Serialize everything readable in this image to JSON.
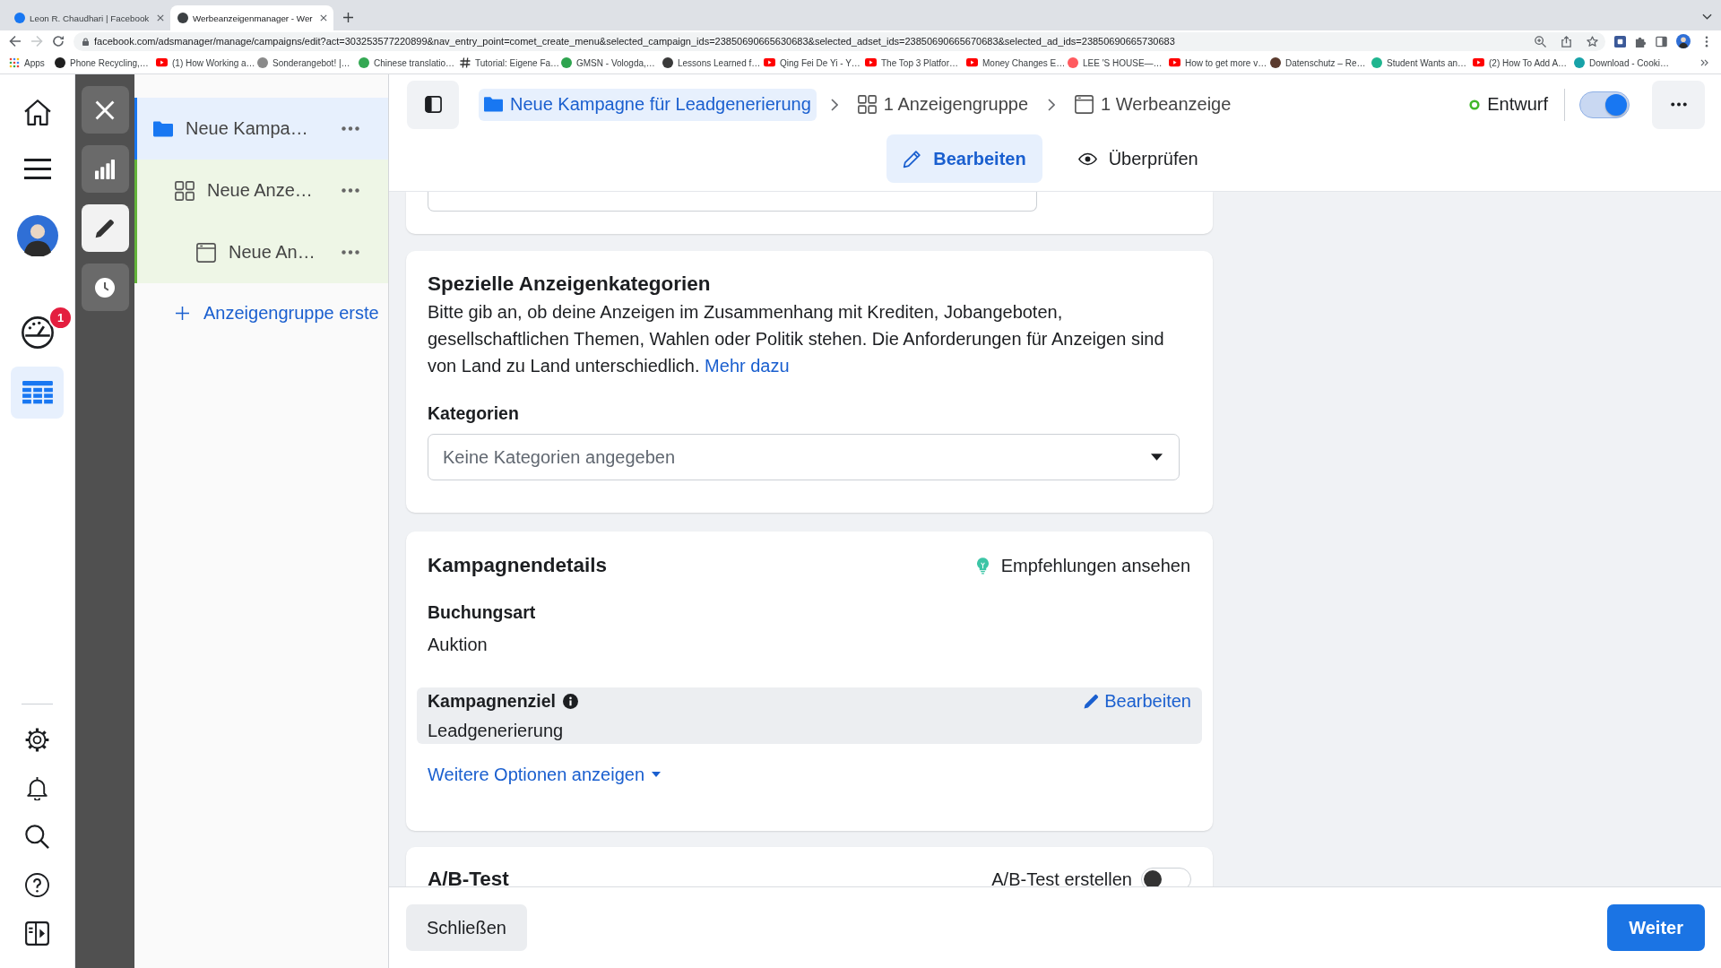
{
  "browser": {
    "tabs": [
      {
        "title": "Leon R. Chaudhari | Facebook",
        "selected": false,
        "color": "#1877f2"
      },
      {
        "title": "Werbeanzeigenmanager - Wer",
        "selected": true,
        "color": "#3c4043"
      }
    ],
    "forward_disabled": true,
    "url": "facebook.com/adsmanager/manage/campaigns/edit?act=303253577220899&nav_entry_point=comet_create_menu&selected_campaign_ids=23850690665630683&selected_adset_ids=23850690665670683&selected_ad_ids=23850690665730683",
    "bookmarks": [
      {
        "label": "Apps",
        "kind": "apps"
      },
      {
        "label": "Phone Recycling,…",
        "kind": "site",
        "color": "#1f1f1f"
      },
      {
        "label": "(1) How Working a…",
        "kind": "video"
      },
      {
        "label": "Sonderangebot! |…",
        "kind": "site",
        "color": "#8a8a8a"
      },
      {
        "label": "Chinese translatio…",
        "kind": "site",
        "color": "#34a853"
      },
      {
        "label": "Tutorial: Eigene Fa…",
        "kind": "hash"
      },
      {
        "label": "GMSN - Vologda,…",
        "kind": "site",
        "color": "#2ea44f"
      },
      {
        "label": "Lessons Learned f…",
        "kind": "site",
        "color": "#3a3a3a"
      },
      {
        "label": "Qing Fei De Yi - Y…",
        "kind": "video"
      },
      {
        "label": "The Top 3 Platfor…",
        "kind": "video"
      },
      {
        "label": "Money Changes E…",
        "kind": "video"
      },
      {
        "label": "LEE 'S HOUSE—…",
        "kind": "site",
        "color": "#ff5a5f"
      },
      {
        "label": "How to get more v…",
        "kind": "video"
      },
      {
        "label": "Datenschutz – Re…",
        "kind": "site",
        "color": "#5b3b2e"
      },
      {
        "label": "Student Wants an…",
        "kind": "site",
        "color": "#1fb58f"
      },
      {
        "label": "(2) How To Add A…",
        "kind": "video"
      },
      {
        "label": "Download - Cooki…",
        "kind": "site",
        "color": "#17a2a8"
      }
    ]
  },
  "nav_rail": {
    "items": [
      {
        "kind": "home",
        "selected": false
      },
      {
        "kind": "menu",
        "selected": false
      },
      {
        "kind": "profile",
        "selected": false
      },
      {
        "kind": "dashboard",
        "selected": false,
        "badge": "1"
      },
      {
        "kind": "table",
        "selected": true
      }
    ],
    "bottom_items": [
      {
        "kind": "settings"
      },
      {
        "kind": "notifications"
      },
      {
        "kind": "search"
      },
      {
        "kind": "help"
      },
      {
        "kind": "panel"
      }
    ]
  },
  "tool_rail": {
    "items": [
      {
        "kind": "close",
        "selected": false
      },
      {
        "kind": "reports",
        "selected": false
      },
      {
        "kind": "edit",
        "selected": true
      },
      {
        "kind": "history",
        "selected": false
      }
    ]
  },
  "tree": {
    "items": [
      {
        "label": "Neue Kampa…",
        "kind": "campaign",
        "selected": true,
        "children": [
          {
            "label": "Neue Anze…",
            "kind": "ad_set",
            "selected": false,
            "highlighted": true,
            "children": [
              {
                "label": "Neue An…",
                "kind": "ad",
                "selected": false,
                "highlighted": true
              }
            ]
          }
        ]
      }
    ],
    "add_link": "Anzeigengruppe erste"
  },
  "header": {
    "breadcrumb": [
      {
        "label": "Neue Kampagne für Leadgenerierung",
        "kind": "campaign",
        "selected": true
      },
      {
        "label": "1 Anzeigengruppe",
        "kind": "ad_set",
        "selected": false
      },
      {
        "label": "1 Werbeanzeige",
        "kind": "ad",
        "selected": false
      }
    ],
    "status": "Entwurf",
    "toggle": {
      "on": true
    },
    "mode_tabs": [
      {
        "label": "Bearbeiten",
        "kind": "edit",
        "selected": true
      },
      {
        "label": "Überprüfen",
        "kind": "review",
        "selected": false
      }
    ]
  },
  "special_categories": {
    "title": "Spezielle Anzeigenkategorien",
    "description": "Bitte gib an, ob deine Anzeigen im Zusammenhang mit Krediten, Jobangeboten, gesellschaftlichen Themen, Wahlen oder Politik stehen. Die Anforderungen für Anzeigen sind von Land zu Land unterschiedlich.",
    "link": "Mehr dazu",
    "field_label": "Kategorien",
    "dropdown": {
      "placeholder": "Keine Kategorien angegeben"
    }
  },
  "campaign_details": {
    "title": "Kampagnendetails",
    "recommendations": "Empfehlungen ansehen",
    "buying_type": {
      "label": "Buchungsart",
      "value": "Auktion"
    },
    "objective": {
      "label": "Kampagnenziel",
      "value": "Leadgenerierung",
      "edit": "Bearbeiten",
      "hovered": true
    },
    "more_options": "Weitere Optionen anzeigen"
  },
  "ab_test": {
    "title": "A/B-Test",
    "toggle_label": "A/B-Test erstellen",
    "on": false
  },
  "footer": {
    "close": "Schließen",
    "next": "Weiter"
  }
}
